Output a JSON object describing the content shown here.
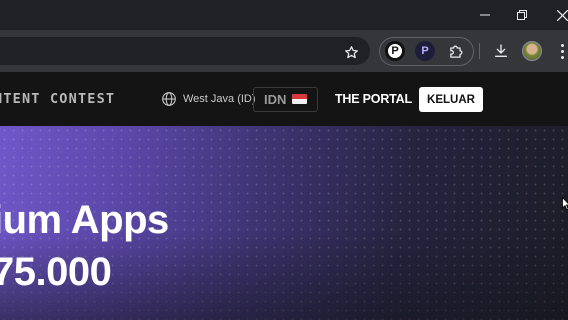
{
  "browser": {
    "window_controls": {
      "minimize_icon": "minimize-icon",
      "restore_icon": "restore-icon",
      "close_icon": "close-icon"
    },
    "toolbar": {
      "bookmark_icon": "star-icon",
      "extensions": [
        {
          "name": "extension-p-white",
          "glyph": "P"
        },
        {
          "name": "extension-p-purple",
          "glyph": "P"
        }
      ],
      "extensions_icon": "puzzle-icon",
      "download_icon": "download-icon",
      "menu_icon": "kebab-menu-icon"
    }
  },
  "site": {
    "header": {
      "contest_label": "NTENT CONTEST",
      "region": "West Java (ID)",
      "language_code": "IDN",
      "portal_label": "THE PORTAL",
      "logout_label": "KELUAR"
    },
    "hero": {
      "title": "ium Apps",
      "amount": "75.000"
    }
  },
  "colors": {
    "accent_purple": "#6f58c9",
    "header_bg": "#141414",
    "flag_red": "#d7373f",
    "flag_white": "#f0f0f0"
  }
}
